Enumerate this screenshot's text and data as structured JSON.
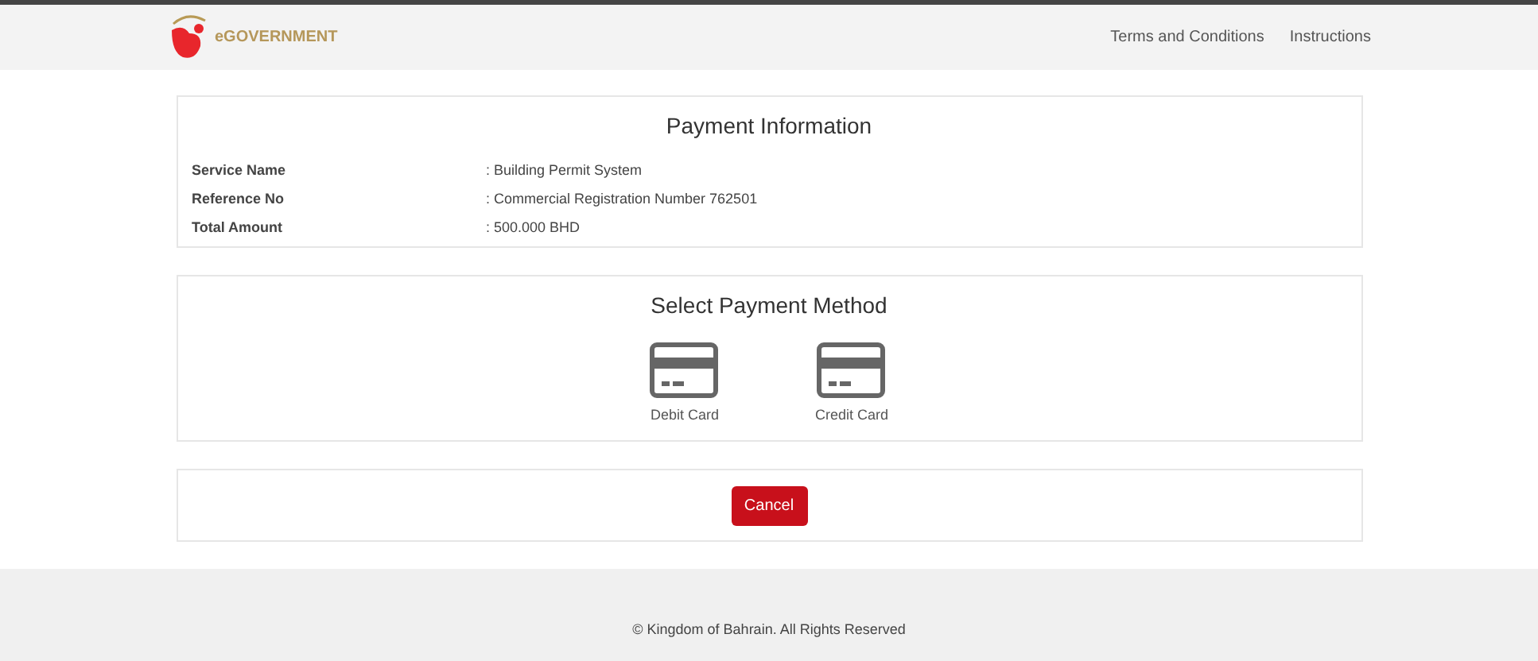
{
  "header": {
    "logo_text": "eGOVERNMENT",
    "links": [
      "Terms and Conditions",
      "Instructions"
    ]
  },
  "payment_info": {
    "title": "Payment Information",
    "rows": [
      {
        "label": "Service Name",
        "value": ": Building Permit System"
      },
      {
        "label": "Reference No",
        "value": ": Commercial Registration Number 762501"
      },
      {
        "label": "Total Amount",
        "value": ": 500.000 BHD"
      }
    ]
  },
  "payment_method": {
    "title": "Select Payment Method",
    "options": [
      {
        "label": "Debit Card"
      },
      {
        "label": "Credit Card"
      }
    ]
  },
  "cancel_button": "Cancel",
  "footer": "© Kingdom of Bahrain. All Rights Reserved"
}
